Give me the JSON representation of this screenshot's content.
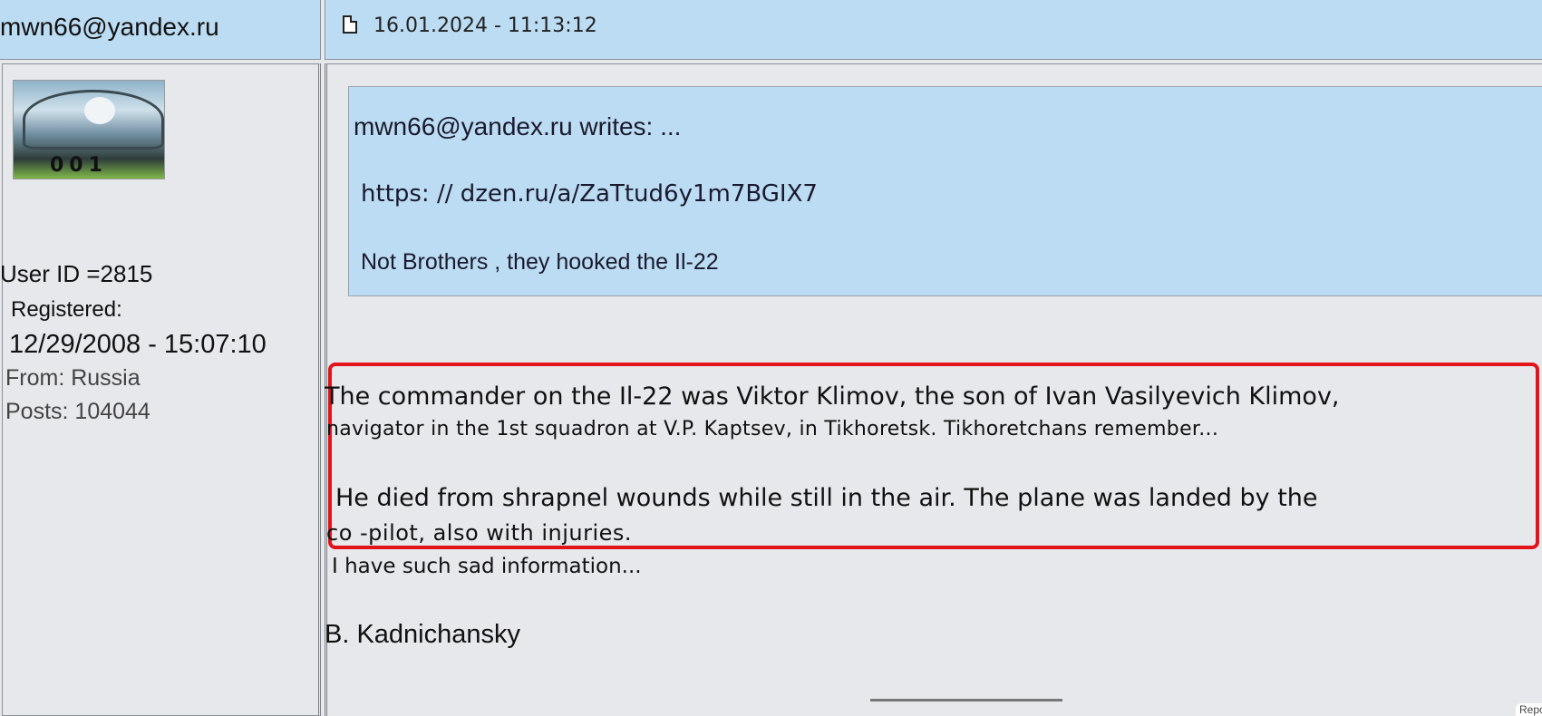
{
  "header": {
    "username": "mwn66@yandex.ru",
    "timestamp": "16.01.2024 - 11:13:12"
  },
  "profile": {
    "user_id": "User ID =2815",
    "registered_label": "Registered:",
    "registered_date": "12/29/2008 - 15:07:10",
    "from": "From: Russia",
    "posts": "Posts: 104044",
    "avatar_text": "001"
  },
  "quote": {
    "header": "mwn66@yandex.ru writes: ...",
    "link": "https: // dzen.ru/a/ZaTtud6y1m7BGIX7",
    "text": "Not Brothers , they hooked the Il-22"
  },
  "post": {
    "line1": "The commander on the Il-22 was Viktor Klimov, the son of Ivan Vasilyevich Klimov,",
    "line2": "navigator in the 1st squadron at V.P. Kaptsev, in Tikhoretsk. Tikhoretchans remember...",
    "line3": "He died from shrapnel wounds while still in the air. The plane was landed by the",
    "line4": "co -pilot, also with injuries.",
    "line5": "I have such sad information...",
    "signature": "B. Kadnichansky"
  },
  "footer": {
    "report": "Repo"
  },
  "colors": {
    "header_bg": "#bcdcf3",
    "highlight_border": "#e3131b",
    "panel_bg": "#e6e8eb"
  }
}
